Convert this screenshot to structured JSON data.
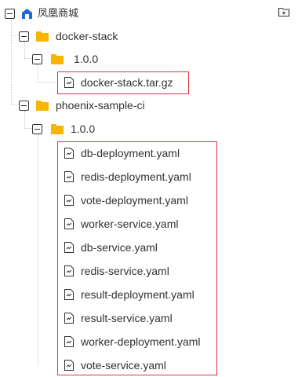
{
  "tree": {
    "root": {
      "label": "凤凰商城",
      "icon": "repository-icon"
    },
    "action_icon": "add-folder-icon",
    "projects": [
      {
        "label": "docker-stack",
        "versions": [
          {
            "label": "1.0.0",
            "files": [
              "docker-stack.tar.gz"
            ]
          }
        ]
      },
      {
        "label": "phoenix-sample-ci",
        "versions": [
          {
            "label": "1.0.0",
            "files": [
              "db-deployment.yaml",
              "redis-deployment.yaml",
              "vote-deployment.yaml",
              "worker-service.yaml",
              "db-service.yaml",
              "redis-service.yaml",
              "result-deployment.yaml",
              "result-service.yaml",
              "worker-deployment.yaml",
              "vote-service.yaml"
            ]
          }
        ]
      }
    ]
  },
  "colors": {
    "folder": "#f7b500",
    "accent": "#1e6bd6",
    "highlight": "#d9363e",
    "text": "#303133"
  }
}
